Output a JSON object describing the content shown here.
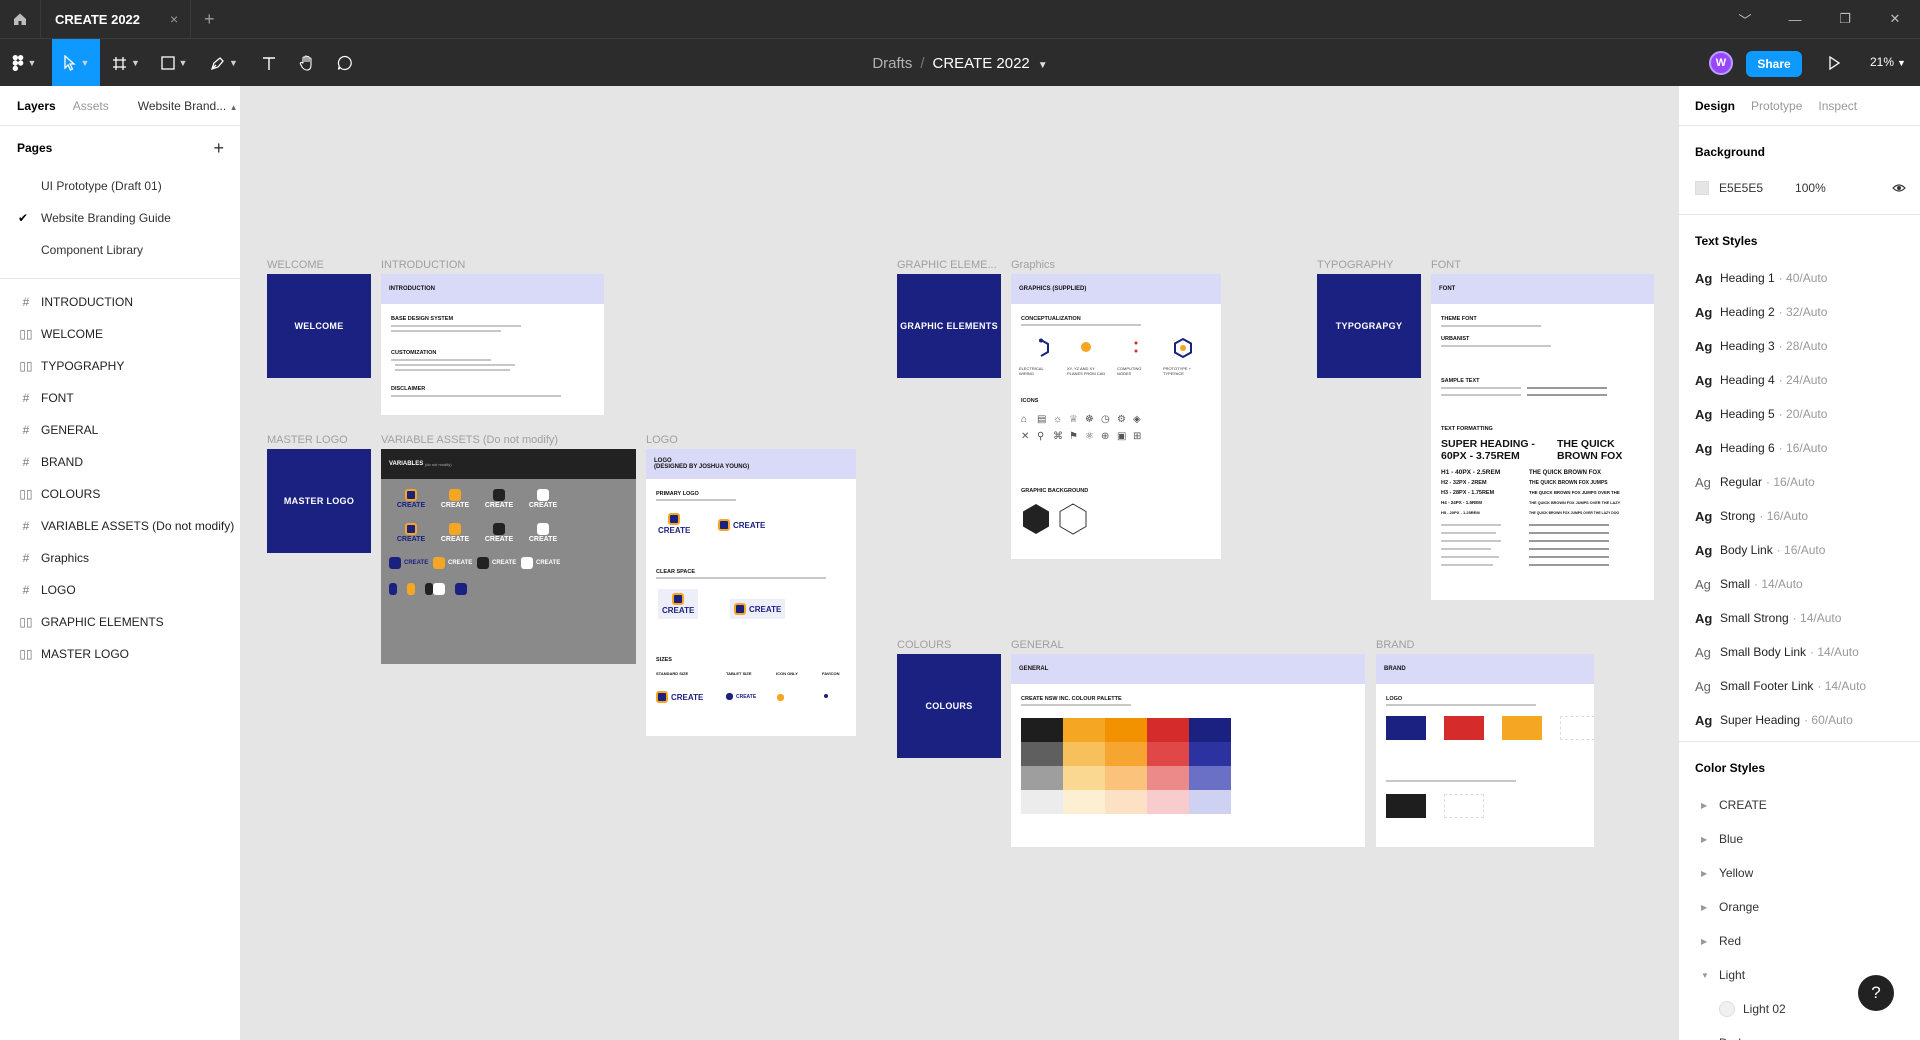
{
  "titlebar": {
    "tab_title": "CREATE 2022",
    "close": "×",
    "new_tab": "+",
    "win_controls": [
      "﹀",
      "—",
      "❐",
      "✕"
    ]
  },
  "toolbar": {
    "breadcrumb_root": "Drafts",
    "breadcrumb_sep": "/",
    "file_name": "CREATE 2022",
    "avatar_initial": "W",
    "share_label": "Share",
    "zoom_level": "21%"
  },
  "left": {
    "tabs": {
      "layers": "Layers",
      "assets": "Assets",
      "page_selector": "Website Brand..."
    },
    "pages_heading": "Pages",
    "pages": [
      {
        "label": "UI Prototype (Draft 01)",
        "selected": false
      },
      {
        "label": "Website Branding Guide",
        "selected": true
      },
      {
        "label": "Component Library",
        "selected": false
      }
    ],
    "layers": [
      {
        "label": "INTRODUCTION",
        "icon": "frame-icon"
      },
      {
        "label": "WELCOME",
        "icon": "columns-icon"
      },
      {
        "label": "TYPOGRAPHY",
        "icon": "columns-icon"
      },
      {
        "label": "FONT",
        "icon": "frame-icon"
      },
      {
        "label": "GENERAL",
        "icon": "frame-icon"
      },
      {
        "label": "BRAND",
        "icon": "frame-icon"
      },
      {
        "label": "COLOURS",
        "icon": "columns-icon"
      },
      {
        "label": "VARIABLE ASSETS (Do not modify)",
        "icon": "frame-icon"
      },
      {
        "label": "Graphics",
        "icon": "frame-icon"
      },
      {
        "label": "LOGO",
        "icon": "frame-icon"
      },
      {
        "label": "GRAPHIC ELEMENTS",
        "icon": "columns-icon"
      },
      {
        "label": "MASTER LOGO",
        "icon": "columns-icon"
      }
    ]
  },
  "canvas": {
    "labels": {
      "welcome": "WELCOME",
      "introduction": "INTRODUCTION",
      "graphic_elements": "GRAPHIC ELEME...",
      "graphics": "Graphics",
      "typography": "TYPOGRAPHY",
      "font": "FONT",
      "master_logo": "MASTER LOGO",
      "variable_assets": "VARIABLE ASSETS (Do not modify)",
      "logo": "LOGO",
      "colours": "COLOURS",
      "general": "GENERAL",
      "brand": "BRAND"
    },
    "welcome_title": "WELCOME",
    "master_logo_title": "MASTER LOGO",
    "graphic_elements_title": "GRAPHIC ELEMENTS",
    "typography_title": "TYPOGRAPGY",
    "colours_title": "COLOURS",
    "intro": {
      "header": "INTRODUCTION",
      "s1": "BASE DESIGN SYSTEM",
      "s2": "CUSTOMIZATION",
      "s3": "DISCLAIMER"
    },
    "variables": {
      "header": "VARIABLES",
      "sub": "(do not modify)",
      "wordmark": "CREATE"
    },
    "logo": {
      "header_1": "LOGO",
      "header_2": "(DESIGNED BY JOSHUA YOUNG)",
      "primary": "PRIMARY LOGO",
      "clear": "CLEAR SPACE",
      "sizes": "SIZES",
      "size_labels": [
        "STANDARD SIZE",
        "TABLET SIZE",
        "ICON ONLY",
        "FAVICON"
      ],
      "wordmark": "CREATE"
    },
    "graphics": {
      "header": "GRAPHICS (SUPPLIED)",
      "s1": "CONCEPTUALIZATION",
      "s2": "ICONS",
      "s3": "GRAPHIC BACKGROUND",
      "concepts": [
        "ELECTRICAL WIRING",
        "XY, YZ AND XY PLANES FROM CAD",
        "COMPUTING NODES",
        "PROTOTYPE + TYPEFACE"
      ]
    },
    "font": {
      "header": "FONT",
      "s1": "THEME FONT",
      "s2": "URBANIST",
      "s3": "SAMPLE TEXT",
      "s4": "TEXT FORMATTING",
      "super_heading": "SUPER HEADING - 60PX - 3.75REM",
      "fox": "THE QUICK BROWN FOX",
      "h_rows": [
        "H1 - 40PX - 2.5REM",
        "H2 - 32PX - 2REM",
        "H3 - 28PX - 1.75REM",
        "H4 - 24PX - 1.5REM",
        "H5 - 20PX - 1.25REM"
      ],
      "fox_rows": [
        "THE QUICK BROWN FOX",
        "THE QUICK BROWN FOX JUMPS",
        "THE QUICK BROWN FOX JUMPS OVER THE",
        "THE QUICK BROWN FOX JUMPS OVER THE LAZY",
        "THE QUICK BROWN FOX JUMPS OVER THE LAZY DOG"
      ]
    },
    "general": {
      "header": "GENERAL",
      "s1": "CREATE NSW INC. COLOUR PALETTE"
    },
    "brand": {
      "header": "BRAND",
      "s1": "LOGO"
    },
    "palette_colors": [
      [
        "#1e1e1e",
        "#f5a623",
        "#f39200",
        "#d62b2b",
        "#1b2180"
      ],
      [
        "#5f5f5f",
        "#f7c05a",
        "#f7a531",
        "#e04848",
        "#2c33a0"
      ],
      [
        "#9e9e9e",
        "#fad891",
        "#fac27a",
        "#ec8a8a",
        "#6b70c7"
      ],
      [
        "#ececec",
        "#fdf0d2",
        "#fde1c4",
        "#f8cccc",
        "#cfd1f2"
      ]
    ],
    "brand_colors": [
      "#1b2180",
      "#d62b2b",
      "#f5a623",
      "#ffffff",
      "#1e1e1e",
      "#ffffff"
    ]
  },
  "right": {
    "tabs": {
      "design": "Design",
      "prototype": "Prototype",
      "inspect": "Inspect"
    },
    "background_heading": "Background",
    "background_hex": "E5E5E5",
    "background_opacity": "100%",
    "text_styles_heading": "Text Styles",
    "text_styles": [
      {
        "name": "Heading 1",
        "size": "· 40/Auto",
        "bold": true
      },
      {
        "name": "Heading 2",
        "size": "· 32/Auto",
        "bold": true
      },
      {
        "name": "Heading 3",
        "size": "· 28/Auto",
        "bold": true
      },
      {
        "name": "Heading 4",
        "size": "· 24/Auto",
        "bold": true
      },
      {
        "name": "Heading 5",
        "size": "· 20/Auto",
        "bold": true
      },
      {
        "name": "Heading 6",
        "size": "· 16/Auto",
        "bold": true
      },
      {
        "name": "Regular",
        "size": "· 16/Auto",
        "bold": false
      },
      {
        "name": "Strong",
        "size": "· 16/Auto",
        "bold": true
      },
      {
        "name": "Body Link",
        "size": "· 16/Auto",
        "bold": true
      },
      {
        "name": "Small",
        "size": "· 14/Auto",
        "bold": false
      },
      {
        "name": "Small Strong",
        "size": "· 14/Auto",
        "bold": true
      },
      {
        "name": "Small Body Link",
        "size": "· 14/Auto",
        "bold": false
      },
      {
        "name": "Small Footer Link",
        "size": "· 14/Auto",
        "bold": false
      },
      {
        "name": "Super Heading",
        "size": "· 60/Auto",
        "bold": true
      }
    ],
    "ag": "Ag",
    "color_styles_heading": "Color Styles",
    "color_styles": [
      "CREATE",
      "Blue",
      "Yellow",
      "Orange",
      "Red",
      "Light"
    ],
    "color_sub": "Light 02",
    "color_after": "Dark",
    "help": "?"
  }
}
